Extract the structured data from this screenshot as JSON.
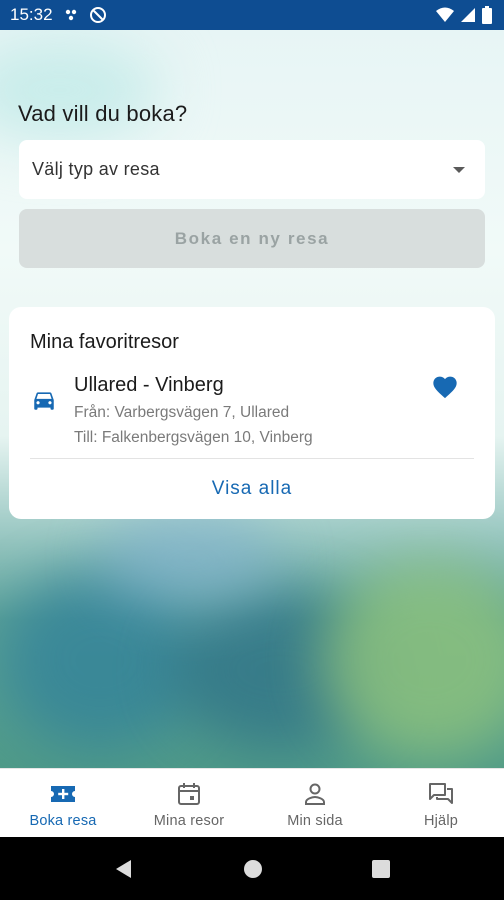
{
  "status_bar": {
    "time": "15:32",
    "left_icons": [
      "settings-icon",
      "blocked-icon"
    ],
    "right_icons": [
      "wifi-icon",
      "signal-icon",
      "battery-icon"
    ]
  },
  "booking": {
    "heading": "Vad vill du boka?",
    "select_placeholder": "Välj typ av resa",
    "book_button_label": "Boka en ny resa"
  },
  "favorites": {
    "title": "Mina favoritresor",
    "items": [
      {
        "icon": "taxi-icon",
        "title": "Ullared - Vinberg",
        "from": "Från: Varbergsvägen 7, Ullared",
        "to": "Till: Falkenbergsvägen 10, Vinberg",
        "favorite": true
      }
    ],
    "show_all_label": "Visa alla"
  },
  "bottom_nav": {
    "items": [
      {
        "label": "Boka resa",
        "icon": "ticket-plus-icon",
        "active": true
      },
      {
        "label": "Mina resor",
        "icon": "calendar-icon",
        "active": false
      },
      {
        "label": "Min sida",
        "icon": "person-icon",
        "active": false
      },
      {
        "label": "Hjälp",
        "icon": "chat-icon",
        "active": false
      }
    ]
  },
  "system_nav": [
    "back-icon",
    "home-icon",
    "recents-icon"
  ],
  "colors": {
    "status_bar": "#0e4d92",
    "accent": "#1769b3",
    "disabled_button": "#d8dedd",
    "text_primary": "#1b1b1b",
    "text_secondary": "#7a7a7a"
  }
}
